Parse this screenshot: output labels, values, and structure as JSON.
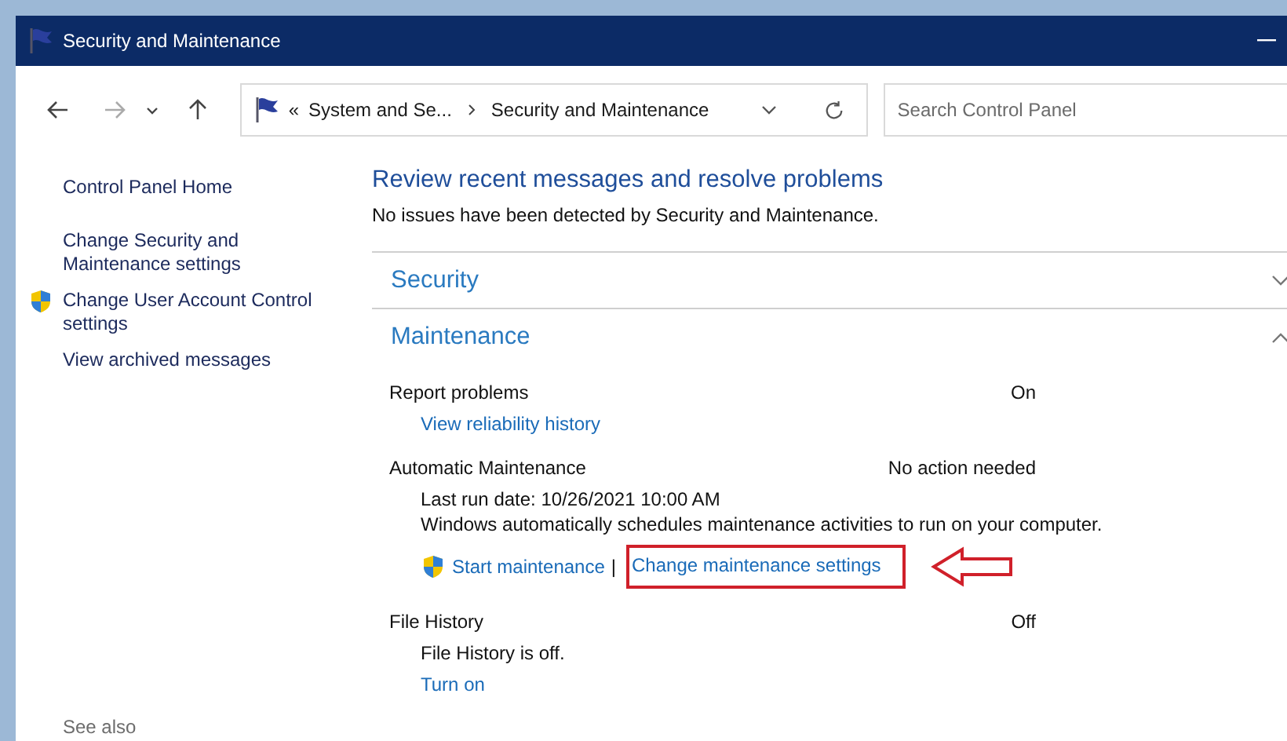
{
  "window": {
    "title": "Security and Maintenance"
  },
  "address": {
    "overflow": "«",
    "crumbs": [
      "System and Se...",
      "Security and Maintenance"
    ]
  },
  "search": {
    "placeholder": "Search Control Panel"
  },
  "sidebar": {
    "items": [
      {
        "label": "Control Panel Home",
        "shield": false
      },
      {
        "label": "Change Security and Maintenance settings",
        "shield": false
      },
      {
        "label": "Change User Account Control settings",
        "shield": true
      },
      {
        "label": "View archived messages",
        "shield": false
      }
    ],
    "see_also": "See also"
  },
  "main": {
    "heading": "Review recent messages and resolve problems",
    "summary": "No issues have been detected by Security and Maintenance.",
    "sections": [
      {
        "title": "Security",
        "expanded": false
      },
      {
        "title": "Maintenance",
        "expanded": true,
        "items": [
          {
            "name": "Report problems",
            "status": "On",
            "links": [
              {
                "label": "View reliability history",
                "shield": false,
                "highlighted": false
              }
            ]
          },
          {
            "name": "Automatic Maintenance",
            "status": "No action needed",
            "details": [
              "Last run date: 10/26/2021 10:00 AM",
              "Windows automatically schedules maintenance activities to run on your computer."
            ],
            "links": [
              {
                "label": "Start maintenance",
                "shield": true,
                "highlighted": false
              },
              {
                "label": "Change maintenance settings",
                "shield": false,
                "highlighted": true
              }
            ],
            "link_separator": "|"
          },
          {
            "name": "File History",
            "status": "Off",
            "details": [
              "File History is off."
            ],
            "links": [
              {
                "label": "Turn on",
                "shield": false,
                "highlighted": false
              }
            ]
          }
        ]
      }
    ]
  }
}
